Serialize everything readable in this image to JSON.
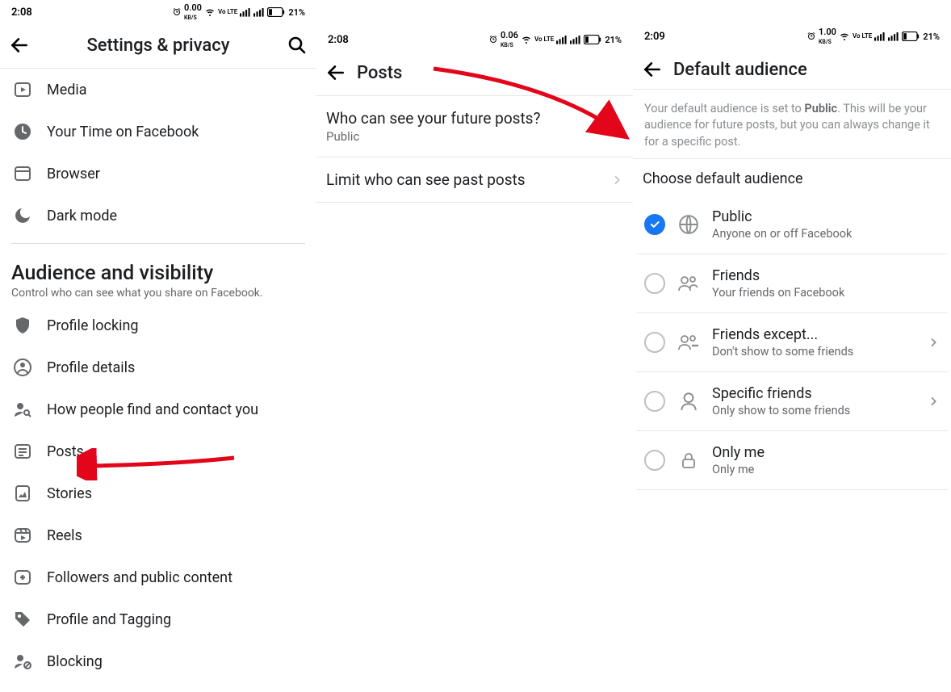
{
  "screen1": {
    "status": {
      "time": "2:08",
      "speed": "0.00",
      "speed_unit": "KB/S",
      "net": "Vo LTE",
      "battery": "21%"
    },
    "header": {
      "title": "Settings & privacy"
    },
    "quick_section": [
      {
        "name": "media",
        "label": "Media"
      },
      {
        "name": "your-time",
        "label": "Your Time on Facebook"
      },
      {
        "name": "browser",
        "label": "Browser"
      },
      {
        "name": "dark-mode",
        "label": "Dark mode"
      }
    ],
    "section_title": "Audience and visibility",
    "section_sub": "Control who can see what you share on Facebook.",
    "audience_items": [
      {
        "name": "profile-locking",
        "label": "Profile locking"
      },
      {
        "name": "profile-details",
        "label": "Profile details"
      },
      {
        "name": "how-people-find",
        "label": "How people find and contact you"
      },
      {
        "name": "posts",
        "label": "Posts"
      },
      {
        "name": "stories",
        "label": "Stories"
      },
      {
        "name": "reels",
        "label": "Reels"
      },
      {
        "name": "followers",
        "label": "Followers and public content"
      },
      {
        "name": "profile-tagging",
        "label": "Profile and Tagging"
      },
      {
        "name": "blocking",
        "label": "Blocking"
      }
    ]
  },
  "screen2": {
    "status": {
      "time": "2:08",
      "speed": "0.06",
      "speed_unit": "KB/S",
      "net": "Vo LTE",
      "battery": "21%"
    },
    "header": {
      "title": "Posts"
    },
    "rows": {
      "future": {
        "title": "Who can see your future posts?",
        "sub": "Public"
      },
      "past": {
        "title": "Limit who can see past posts"
      }
    }
  },
  "screen3": {
    "status": {
      "time": "2:09",
      "speed": "1.00",
      "speed_unit": "KB/S",
      "net": "Vo LTE",
      "battery": "21%"
    },
    "header": {
      "title": "Default audience"
    },
    "desc_pre": "Your default audience is set to ",
    "desc_bold": "Public",
    "desc_post": ". This will be your audience for future posts, but you can always change it for a specific post.",
    "choose": "Choose default audience",
    "options": {
      "public": {
        "title": "Public",
        "sub": "Anyone on or off Facebook",
        "selected": true
      },
      "friends": {
        "title": "Friends",
        "sub": "Your friends on Facebook"
      },
      "except": {
        "title": "Friends except...",
        "sub": "Don't show to some friends",
        "chevron": true
      },
      "specific": {
        "title": "Specific friends",
        "sub": "Only show to some friends",
        "chevron": true
      },
      "onlyme": {
        "title": "Only me",
        "sub": "Only me"
      }
    }
  }
}
